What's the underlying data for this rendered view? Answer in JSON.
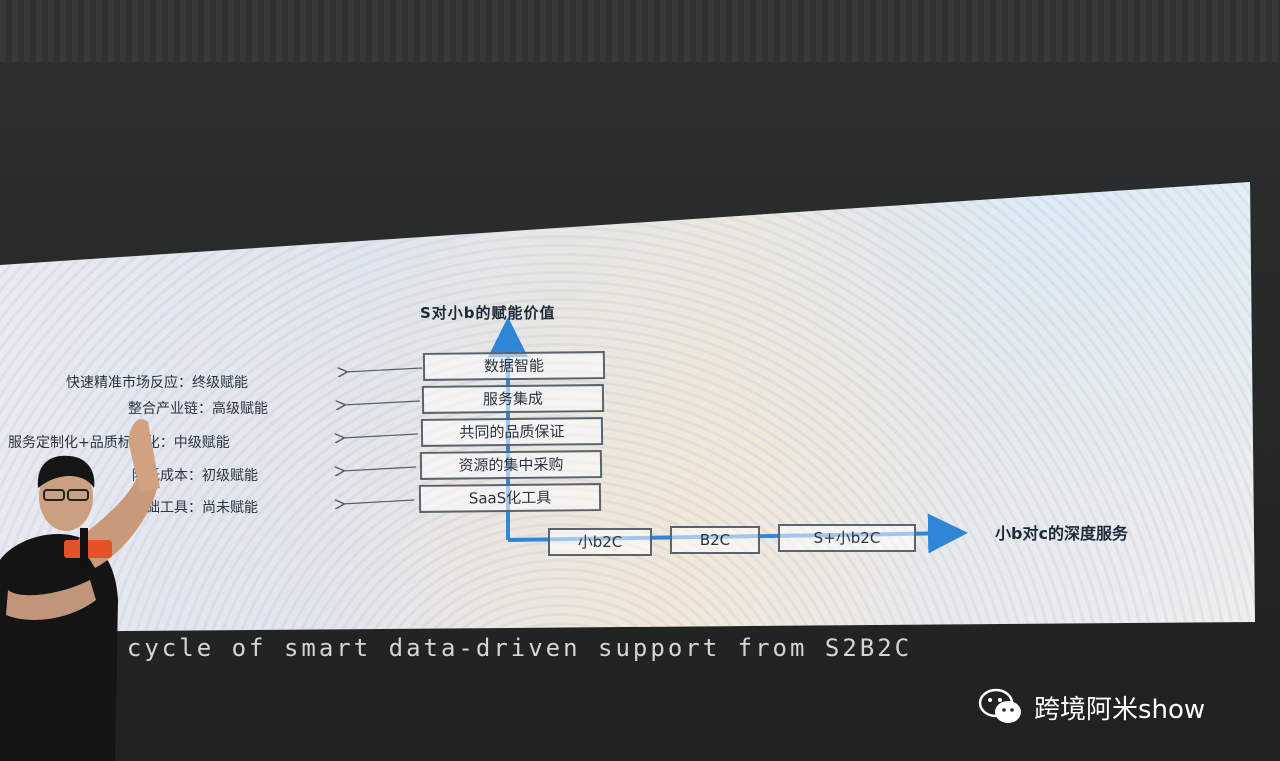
{
  "slide": {
    "title": "S对小b的赋能价值",
    "levels": [
      {
        "box": "数据智能",
        "label": "快速精准市场反应：终级赋能"
      },
      {
        "box": "服务集成",
        "label": "整合产业链：高级赋能"
      },
      {
        "box": "共同的品质保证",
        "label": "服务定制化+品质标准化：中级赋能"
      },
      {
        "box": "资源的集中采购",
        "label": "降低成本：初级赋能"
      },
      {
        "box": "SaaS化工具",
        "label": "基础工具：尚未赋能"
      }
    ],
    "bottom_boxes": [
      "小b2C",
      "B2C",
      "S+小b2C"
    ],
    "right_label": "小b对c的深度服务"
  },
  "caption": "A cycle of smart data-driven support from S2B2C",
  "watermark": {
    "text": "跨境阿米show",
    "icon": "wechat-icon"
  },
  "colors": {
    "arrow_blue": "#2f86d6",
    "screen_light": "#e9ecef",
    "stage_dark": "#272b2a"
  }
}
